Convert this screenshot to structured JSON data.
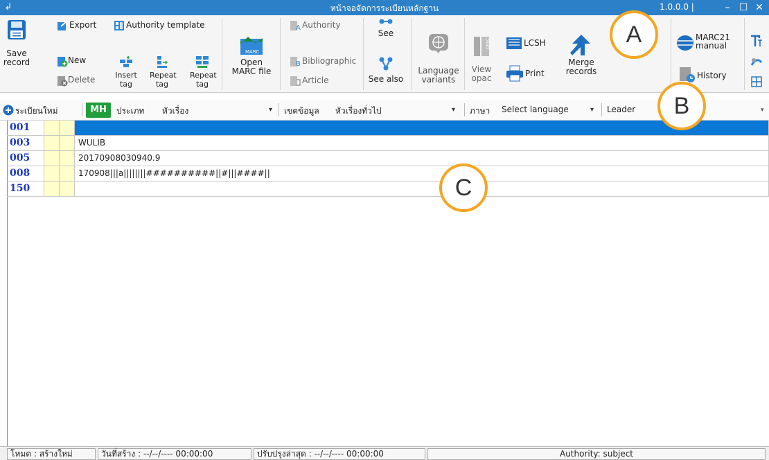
{
  "window": {
    "title": "หน้าจอจัดการระเบียนหลักฐาน",
    "version": "1.0.0.0 |",
    "minimize": "–",
    "maximize": "☐",
    "close": "✕"
  },
  "ribbon": {
    "save_record": "Save\nrecord",
    "export": "Export",
    "new": "New",
    "delete": "Delete",
    "authority_template": "Authority template",
    "insert_tag": "Insert\ntag",
    "repeat_tag_1": "Repeat\ntag",
    "repeat_tag_2": "Repeat\ntag",
    "open_marc_file": "Open\nMARC file",
    "marc_icon_text": "MARC",
    "authority": "Authority",
    "bibliographic": "Bibliographic",
    "article": "Article",
    "see": "See",
    "see_also": "See also",
    "language_variants": "Language\nvariants",
    "view_opac": "View\nopac",
    "lcsh": "LCSH",
    "print": "Print",
    "merge_records": "Merge\nrecords",
    "marc21_manual": "MARC21\nmanual",
    "history": "History"
  },
  "fieldbar": {
    "new_record": "ระเบียนใหม่",
    "badge": "MH",
    "type_label": "ประเภท",
    "type_value": "หัวเรื่อง",
    "scope_label": "เขตข้อมูล",
    "scope_value": "หัวเรื่องทั่วไป",
    "language_label": "ภาษา",
    "language_value": "Select language",
    "leader": "Leader"
  },
  "records": [
    {
      "tag": "001",
      "value": "",
      "selected": true
    },
    {
      "tag": "003",
      "value": "WULIB"
    },
    {
      "tag": "005",
      "value": "20170908030940.9"
    },
    {
      "tag": "008",
      "value": "170908|||a||||||||##########||#|||####||"
    },
    {
      "tag": "150",
      "value": ""
    }
  ],
  "status": {
    "mode": "โหมด : สร้างใหม่",
    "created": "วันที่สร้าง :  --/--/----  00:00:00",
    "updated": "ปรับปรุงล่าสุด :  --/--/----  00:00:00",
    "authority": "Authority: subject"
  },
  "callouts": {
    "a": "A",
    "b": "B",
    "c": "C"
  },
  "colors": {
    "titlebar": "#2c80c8",
    "selected_row": "#0a78d7",
    "tag_text": "#1a35c7",
    "indicator": "#ffffcc",
    "callout_ring": "#f5a623",
    "badge": "#1f9e3a"
  }
}
